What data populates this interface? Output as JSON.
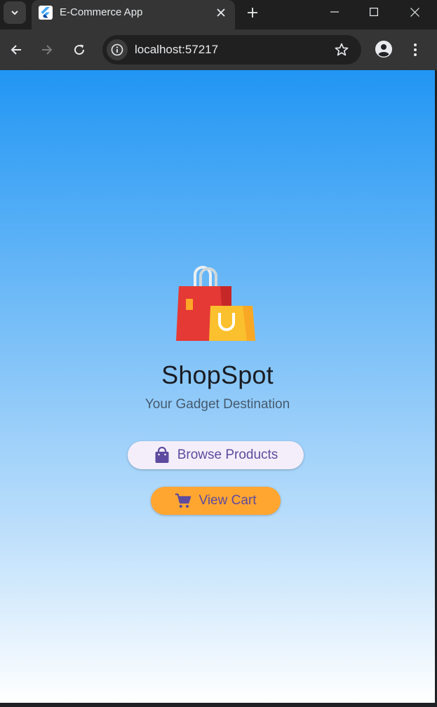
{
  "browser": {
    "tab_title": "E-Commerce App",
    "url": "localhost:57217",
    "icons": {
      "tab_search": "chevron-down-icon",
      "favicon": "flutter-icon",
      "tab_close": "close-icon",
      "new_tab": "plus-icon",
      "minimize": "minimize-icon",
      "maximize": "maximize-icon",
      "window_close": "close-icon",
      "back": "arrow-left-icon",
      "forward": "arrow-right-icon",
      "reload": "reload-icon",
      "site_info": "info-icon",
      "bookmark": "star-icon",
      "profile": "person-icon",
      "menu": "more-vert-icon"
    }
  },
  "app": {
    "logo_icon": "shopping-bags-icon",
    "title": "ShopSpot",
    "subtitle": "Your Gadget Destination",
    "buttons": {
      "browse": {
        "label": "Browse Products",
        "icon": "shopping-bag-icon"
      },
      "cart": {
        "label": "View Cart",
        "icon": "shopping-cart-icon"
      }
    }
  },
  "colors": {
    "gradient_top": "#2196f3",
    "gradient_bottom": "#ffffff",
    "button_text": "#5e4a9e",
    "browse_button_bg": "#f4eefa",
    "cart_button_bg": "#ffa630",
    "title_text": "#1a1c22"
  }
}
